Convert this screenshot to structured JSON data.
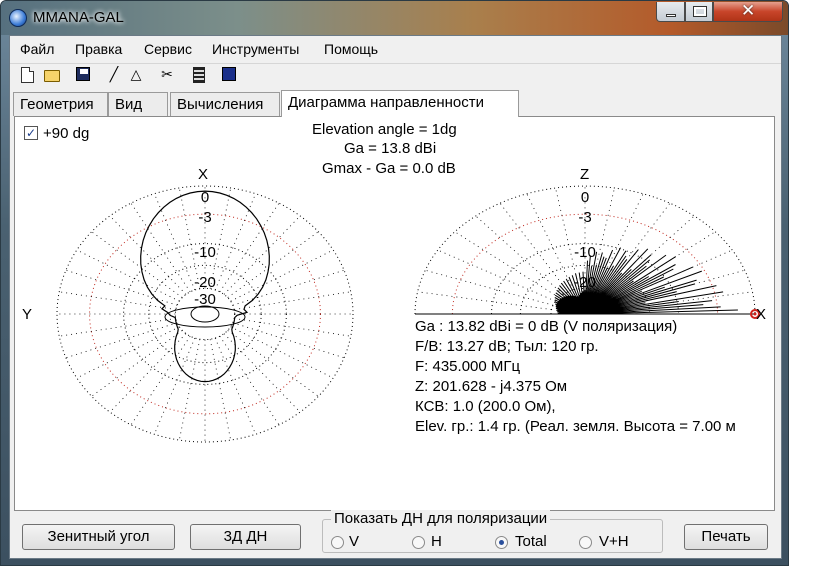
{
  "window": {
    "title": "MMANA-GAL",
    "close_glyph": "✕"
  },
  "menu": [
    "Файл",
    "Правка",
    "Сервис",
    "Инструменты",
    "Помощь"
  ],
  "toolbar": {
    "icons": [
      "new-document-icon",
      "open-folder-icon",
      "save-disk-icon",
      "line-tool-icon",
      "triangle-tool-icon",
      "tools-icon",
      "calculator-icon",
      "computer-icon"
    ],
    "line_glyph": "╱",
    "triangle_glyph": "△",
    "tools_glyph": "✂"
  },
  "tabs": [
    {
      "label": "Геометрия",
      "active": false
    },
    {
      "label": "Вид",
      "active": false
    },
    {
      "label": "Вычисления",
      "active": false
    },
    {
      "label": "Диаграмма направленности",
      "active": true
    }
  ],
  "panel": {
    "checkbox": {
      "label": "+90 dg",
      "checked": true,
      "glyph": "✓"
    },
    "header": {
      "elevation": "Elevation angle =    1dg",
      "ga": "Ga = 13.8 dBi",
      "gmax": "Gmax - Ga = 0.0 dB"
    },
    "left_plot": {
      "axis_top": "X",
      "axis_left": "Y"
    },
    "right_plot": {
      "axis_top": "Z",
      "axis_right": "X"
    },
    "rings": [
      "0",
      "-3",
      "-10",
      "-20",
      "-30"
    ],
    "info": [
      "Ga : 13.82 dBi = 0 dB  (V поляризация)",
      "F/B: 13.27 dB; Тыл: 120 гр.",
      "F: 435.000 МГц",
      "Z: 201.628 - j4.375 Ом",
      "КСВ: 1.0 (200.0 Ом),",
      "Elev. гр.: 1.4 гр. (Реал. земля. Высота = 7.00 м"
    ]
  },
  "buttons": {
    "zenith": "Зенитный угол",
    "3d": "3Д   ДН",
    "print": "Печать"
  },
  "polarization": {
    "legend": "Показать ДН для поляризации",
    "options": [
      {
        "label": "V",
        "selected": false
      },
      {
        "label": "H",
        "selected": false
      },
      {
        "label": "Total",
        "selected": true
      },
      {
        "label": "V+H",
        "selected": false
      }
    ]
  },
  "colors": {
    "grid_red": "#c0281e",
    "grid_black": "#000000",
    "marker": "#d0201a"
  }
}
